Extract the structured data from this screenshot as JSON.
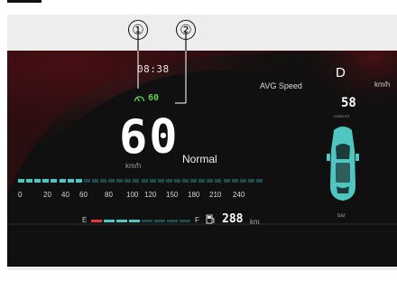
{
  "callouts": {
    "one": "①",
    "two": "②"
  },
  "cluster": {
    "clock": "08:38",
    "speed_limit": "60",
    "speed": "60",
    "speed_unit": "km/h",
    "drive_mode": "Normal",
    "speed_scale": [
      "0",
      "20",
      "40",
      "60",
      "80",
      "100",
      "120",
      "150",
      "180",
      "210",
      "240"
    ],
    "speed_fill_fraction": 0.25,
    "fuel": {
      "empty_label": "E",
      "full_label": "F",
      "level_fraction": 0.35,
      "range_value": "288",
      "range_unit": "km"
    },
    "right_panel": {
      "avg_speed_label": "AVG Speed",
      "gear": "D",
      "unit_label": "km/h",
      "avg_speed_value": "58",
      "avg_caption": "H:MM:SS",
      "pressure_caption": "bar"
    }
  },
  "colors": {
    "dash_bg": "#101010",
    "dash_red_glow": "#4a0f12",
    "accent_teal": "#4fc6c0",
    "speed_limit_green": "#5ed14f",
    "fuel_red": "#e03a3a"
  },
  "icons": {
    "speed_limit": "speedometer-icon",
    "fuel": "fuel-pump-icon",
    "car": "car-topview-icon"
  }
}
